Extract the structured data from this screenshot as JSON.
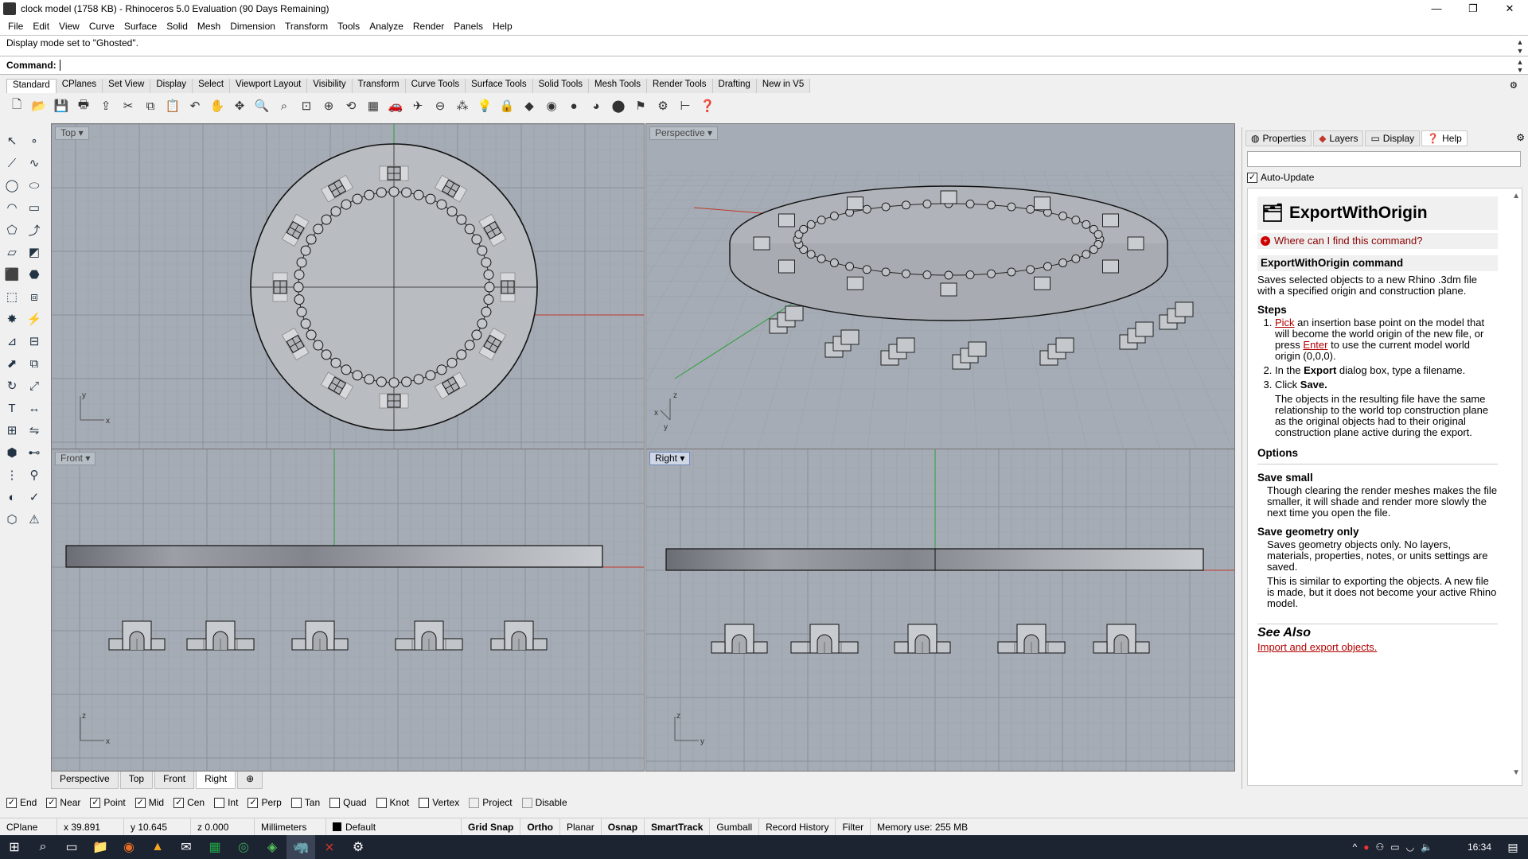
{
  "window": {
    "title": "clock model (1758 KB) - Rhinoceros 5.0 Evaluation (90 Days Remaining)",
    "minimize": "—",
    "restore": "❐",
    "close": "✕"
  },
  "menu": [
    "File",
    "Edit",
    "View",
    "Curve",
    "Surface",
    "Solid",
    "Mesh",
    "Dimension",
    "Transform",
    "Tools",
    "Analyze",
    "Render",
    "Panels",
    "Help"
  ],
  "history": "Display mode set to \"Ghosted\".",
  "command": {
    "label": "Command:",
    "value": ""
  },
  "toolbar_tabs": [
    "Standard",
    "CPlanes",
    "Set View",
    "Display",
    "Select",
    "Viewport Layout",
    "Visibility",
    "Transform",
    "Curve Tools",
    "Surface Tools",
    "Solid Tools",
    "Mesh Tools",
    "Render Tools",
    "Drafting",
    "New in V5"
  ],
  "toolbar_active_tab": "Standard",
  "viewports": {
    "top": {
      "label": "Top ▾"
    },
    "perspective": {
      "label": "Perspective ▾"
    },
    "front": {
      "label": "Front ▾"
    },
    "right": {
      "label": "Right ▾"
    },
    "axis": {
      "x": "x",
      "y": "y",
      "z": "z"
    }
  },
  "viewport_tabs": [
    "Perspective",
    "Top",
    "Front",
    "Right",
    "⊕"
  ],
  "viewport_active_tab": "Right",
  "osnap": [
    {
      "label": "End",
      "checked": true
    },
    {
      "label": "Near",
      "checked": true
    },
    {
      "label": "Point",
      "checked": true
    },
    {
      "label": "Mid",
      "checked": true
    },
    {
      "label": "Cen",
      "checked": true
    },
    {
      "label": "Int",
      "checked": false
    },
    {
      "label": "Perp",
      "checked": true
    },
    {
      "label": "Tan",
      "checked": false
    },
    {
      "label": "Quad",
      "checked": false
    },
    {
      "label": "Knot",
      "checked": false
    },
    {
      "label": "Vertex",
      "checked": false
    },
    {
      "label": "Project",
      "checked": false
    },
    {
      "label": "Disable",
      "checked": false
    }
  ],
  "status": {
    "cplane": "CPlane",
    "x": "x 39.891",
    "y": "y 10.645",
    "z": "z 0.000",
    "units": "Millimeters",
    "layer": "Default",
    "layer_color": "#000000",
    "toggles": [
      {
        "label": "Grid Snap",
        "on": true
      },
      {
        "label": "Ortho",
        "on": true
      },
      {
        "label": "Planar",
        "on": false
      },
      {
        "label": "Osnap",
        "on": true
      },
      {
        "label": "SmartTrack",
        "on": true
      },
      {
        "label": "Gumball",
        "on": false
      },
      {
        "label": "Record History",
        "on": false
      },
      {
        "label": "Filter",
        "on": false
      }
    ],
    "memory": "Memory use: 255 MB"
  },
  "panel": {
    "tabs": [
      {
        "label": "Properties",
        "icon": "properties-icon"
      },
      {
        "label": "Layers",
        "icon": "layers-icon"
      },
      {
        "label": "Display",
        "icon": "display-icon"
      },
      {
        "label": "Help",
        "icon": "help-icon"
      }
    ],
    "active_tab": "Help",
    "auto_update": "Auto-Update",
    "help": {
      "title": "ExportWithOrigin",
      "where": "Where can I find this command?",
      "section_title": "ExportWithOrigin command",
      "intro": "Saves selected objects to a new Rhino .3dm file with a specified origin and construction plane.",
      "steps_heading": "Steps",
      "step1_link1": "Pick",
      "step1_text1": " an insertion base point on the model that will become the world origin of the new file, or press ",
      "step1_link2": "Enter",
      "step1_text2": " to use the current model world origin (0,0,0).",
      "step2_pre": "In the ",
      "step2_bold": "Export",
      "step2_post": " dialog box, type a filename.",
      "step3_pre": "Click ",
      "step3_bold": "Save.",
      "step3_note": "The objects in the resulting file have the same relationship to the world top construction plane as the original objects had to their original construction plane active during the export.",
      "options_heading": "Options",
      "opt1_title": "Save small",
      "opt1_text": "Though clearing the render meshes makes the file smaller, it will shade and render more slowly the next time you open the file.",
      "opt2_title": "Save geometry only",
      "opt2_text": "Saves geometry objects only. No layers, materials, properties, notes, or units settings are saved.",
      "opt2_text2": "This is similar to exporting the objects. A new file is made, but it does not become your active Rhino model.",
      "see_also": "See Also",
      "see_also_link": "Import and export objects."
    }
  },
  "taskbar": {
    "time": "16:34"
  },
  "colors": {
    "viewport_bg": "#a5acb5",
    "grid_minor": "#9aa1aa",
    "grid_major": "#8a9099",
    "x_axis": "#c0392b",
    "y_axis": "#2e9e3e"
  }
}
